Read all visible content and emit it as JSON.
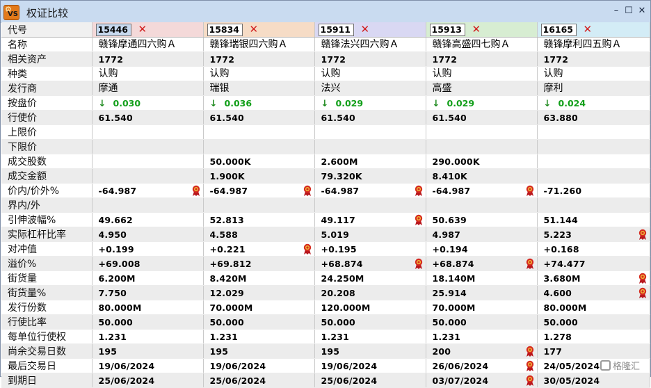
{
  "window": {
    "title": "权证比较"
  },
  "columns": [
    {
      "code": "15446",
      "name": "赣锋摩通四六购Ａ",
      "underlying": "1772",
      "type": "认购",
      "issuer": "摩通",
      "bid": "0.030",
      "strike": "61.540",
      "upper_limit": "",
      "lower_limit": "",
      "volume": "",
      "turnover": "",
      "moneyness": "-64.987",
      "within_range": "",
      "implied_vol": "49.662",
      "eff_gearing": "4.950",
      "delta": "+0.199",
      "premium": "+69.008",
      "outstanding": "6.200M",
      "outstanding_pct": "7.750",
      "issue_size": "80.000M",
      "conv_ratio": "50.000",
      "ent_ratio": "1.231",
      "days_left": "195",
      "last_trade": "19/06/2024",
      "expiry": "25/06/2024"
    },
    {
      "code": "15834",
      "name": "赣锋瑞银四六购Ａ",
      "underlying": "1772",
      "type": "认购",
      "issuer": "瑞银",
      "bid": "0.036",
      "strike": "61.540",
      "upper_limit": "",
      "lower_limit": "",
      "volume": "50.000K",
      "turnover": "1.900K",
      "moneyness": "-64.987",
      "within_range": "",
      "implied_vol": "52.813",
      "eff_gearing": "4.588",
      "delta": "+0.221",
      "premium": "+69.812",
      "outstanding": "8.420M",
      "outstanding_pct": "12.029",
      "issue_size": "70.000M",
      "conv_ratio": "50.000",
      "ent_ratio": "1.231",
      "days_left": "195",
      "last_trade": "19/06/2024",
      "expiry": "25/06/2024"
    },
    {
      "code": "15911",
      "name": "赣锋法兴四六购Ａ",
      "underlying": "1772",
      "type": "认购",
      "issuer": "法兴",
      "bid": "0.029",
      "strike": "61.540",
      "upper_limit": "",
      "lower_limit": "",
      "volume": "2.600M",
      "turnover": "79.320K",
      "moneyness": "-64.987",
      "within_range": "",
      "implied_vol": "49.117",
      "eff_gearing": "5.019",
      "delta": "+0.195",
      "premium": "+68.874",
      "outstanding": "24.250M",
      "outstanding_pct": "20.208",
      "issue_size": "120.000M",
      "conv_ratio": "50.000",
      "ent_ratio": "1.231",
      "days_left": "195",
      "last_trade": "19/06/2024",
      "expiry": "25/06/2024"
    },
    {
      "code": "15913",
      "name": "赣锋高盛四七购Ａ",
      "underlying": "1772",
      "type": "认购",
      "issuer": "高盛",
      "bid": "0.029",
      "strike": "61.540",
      "upper_limit": "",
      "lower_limit": "",
      "volume": "290.000K",
      "turnover": "8.410K",
      "moneyness": "-64.987",
      "within_range": "",
      "implied_vol": "50.639",
      "eff_gearing": "4.987",
      "delta": "+0.194",
      "premium": "+68.874",
      "outstanding": "18.140M",
      "outstanding_pct": "25.914",
      "issue_size": "70.000M",
      "conv_ratio": "50.000",
      "ent_ratio": "1.231",
      "days_left": "200",
      "last_trade": "26/06/2024",
      "expiry": "03/07/2024"
    },
    {
      "code": "16165",
      "name": "赣锋摩利四五购Ａ",
      "underlying": "1772",
      "type": "认购",
      "issuer": "摩利",
      "bid": "0.024",
      "strike": "63.880",
      "upper_limit": "",
      "lower_limit": "",
      "volume": "",
      "turnover": "",
      "moneyness": "-71.260",
      "within_range": "",
      "implied_vol": "51.144",
      "eff_gearing": "5.223",
      "delta": "+0.168",
      "premium": "+74.477",
      "outstanding": "3.680M",
      "outstanding_pct": "4.600",
      "issue_size": "80.000M",
      "conv_ratio": "50.000",
      "ent_ratio": "1.278",
      "days_left": "177",
      "last_trade": "24/05/2024",
      "expiry": "30/05/2024"
    }
  ],
  "rows": [
    {
      "key": "code",
      "label": "代号"
    },
    {
      "key": "name",
      "label": "名称"
    },
    {
      "key": "underlying",
      "label": "相关资产"
    },
    {
      "key": "type",
      "label": "种类"
    },
    {
      "key": "issuer",
      "label": "发行商"
    },
    {
      "key": "bid",
      "label": "按盘价"
    },
    {
      "key": "strike",
      "label": "行使价"
    },
    {
      "key": "upper_limit",
      "label": "上限价"
    },
    {
      "key": "lower_limit",
      "label": "下限价"
    },
    {
      "key": "volume",
      "label": "成交股数"
    },
    {
      "key": "turnover",
      "label": "成交金额"
    },
    {
      "key": "moneyness",
      "label": "价内/价外%"
    },
    {
      "key": "within_range",
      "label": "界内/外"
    },
    {
      "key": "implied_vol",
      "label": "引伸波幅%"
    },
    {
      "key": "eff_gearing",
      "label": "实际杠杆比率"
    },
    {
      "key": "delta",
      "label": "对冲值"
    },
    {
      "key": "premium",
      "label": "溢价%"
    },
    {
      "key": "outstanding",
      "label": "街货量"
    },
    {
      "key": "outstanding_pct",
      "label": "街货量%"
    },
    {
      "key": "issue_size",
      "label": "发行份数"
    },
    {
      "key": "conv_ratio",
      "label": "行使比率"
    },
    {
      "key": "ent_ratio",
      "label": "每单位行使权"
    },
    {
      "key": "days_left",
      "label": "尚余交易日数"
    },
    {
      "key": "last_trade",
      "label": "最后交易日"
    },
    {
      "key": "expiry",
      "label": "到期日"
    }
  ],
  "text_rows": [
    "name",
    "type",
    "issuer"
  ],
  "badges": {
    "moneyness": [
      0,
      1,
      2,
      3
    ],
    "implied_vol": [
      2
    ],
    "eff_gearing": [
      4
    ],
    "delta": [
      1
    ],
    "premium": [
      2,
      3
    ],
    "outstanding": [
      4
    ],
    "outstanding_pct": [
      4
    ],
    "days_left": [
      3
    ],
    "last_trade": [
      3
    ],
    "expiry": [
      3
    ]
  },
  "icons": {
    "app": "vs-gear-app-icon",
    "bid_arrow": "green-down-arrow-icon",
    "remove": "red-x-close-icon",
    "badge": "red-award-ribbon-icon",
    "minimize": "minimize-icon",
    "maximize": "maximize-icon",
    "close": "close-icon"
  },
  "colors": {
    "col0": "#f4d9d9",
    "col1": "#f6dcc6",
    "col2": "#d9d8f3",
    "col3": "#d7edd2",
    "col4": "#d3ecf6",
    "bid_green": "#119f19",
    "badge_red": "#d62a1e"
  },
  "watermark": "格隆汇"
}
